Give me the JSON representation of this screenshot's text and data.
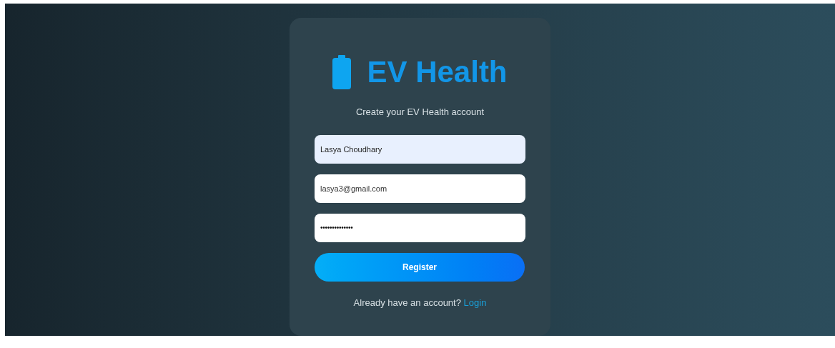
{
  "brand": {
    "title": "EV Health",
    "subtitle": "Create your EV Health account"
  },
  "fields": [
    {
      "kind": "text",
      "value": "Lasya Choudhary",
      "autofilled": true
    },
    {
      "kind": "email",
      "value": "lasya3@gmail.com",
      "autofilled": false
    },
    {
      "kind": "password",
      "value": "••••••••••••••",
      "autofilled": false
    }
  ],
  "submit": "Register",
  "footer": {
    "text": "Already have an account?",
    "link": "Login"
  }
}
